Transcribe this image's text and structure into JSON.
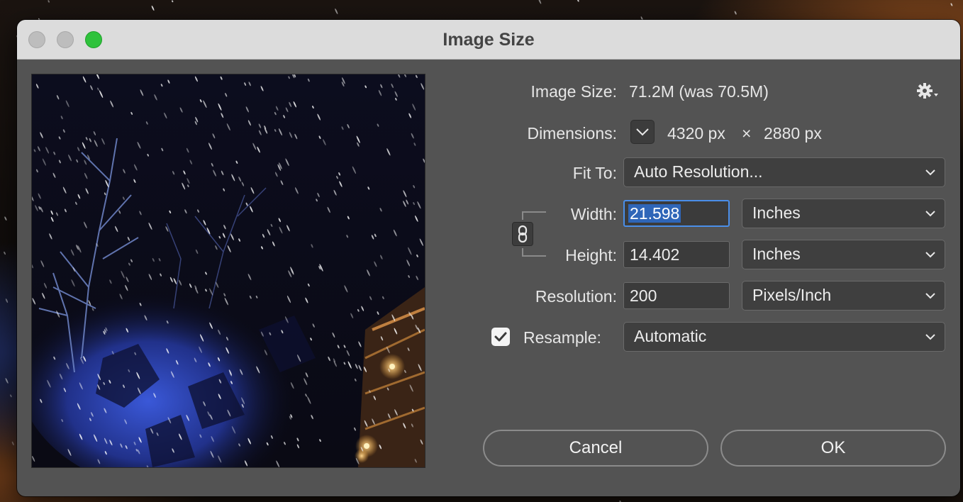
{
  "window": {
    "title": "Image Size",
    "traffic_lights": [
      "close",
      "minimize",
      "zoom"
    ]
  },
  "preview": {
    "icon": "image-preview"
  },
  "image_size": {
    "label": "Image Size:",
    "value": "71.2M (was 70.5M)"
  },
  "settings": {
    "icon": "gear-icon"
  },
  "dimensions": {
    "label": "Dimensions:",
    "width": "4320 px",
    "times": "×",
    "height": "2880 px"
  },
  "fit_to": {
    "label": "Fit To:",
    "value": "Auto Resolution..."
  },
  "width": {
    "label": "Width:",
    "value": "21.598",
    "unit": "Inches"
  },
  "height": {
    "label": "Height:",
    "value": "14.402",
    "unit": "Inches"
  },
  "resolution": {
    "label": "Resolution:",
    "value": "200",
    "unit": "Pixels/Inch"
  },
  "resample": {
    "label": "Resample:",
    "checked": true,
    "value": "Automatic"
  },
  "buttons": {
    "cancel": "Cancel",
    "ok": "OK"
  },
  "colors": {
    "dialog_bg": "#535353",
    "titlebar_bg": "#dcdcdc",
    "focus_ring": "#4a8ee8",
    "zoom_button": "#2fc23c"
  }
}
